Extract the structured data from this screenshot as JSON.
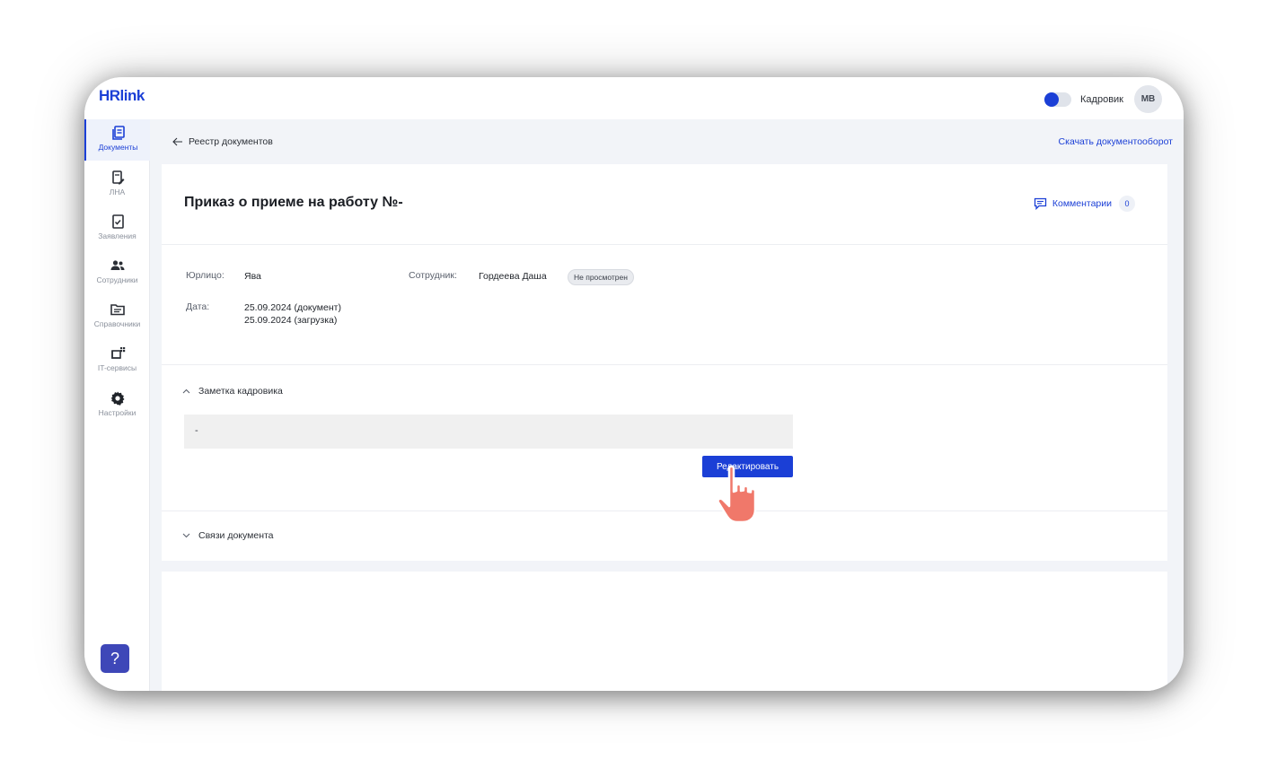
{
  "app": {
    "logo_text": "HRlink"
  },
  "header": {
    "role_label": "Кадровик",
    "avatar_initials": "МВ",
    "role_toggle_on": true
  },
  "sidebar": {
    "items": [
      {
        "label": "Документы",
        "icon": "documents-icon",
        "active": true
      },
      {
        "label": "ЛНА",
        "icon": "lna-icon"
      },
      {
        "label": "Заявления",
        "icon": "applications-icon"
      },
      {
        "label": "Сотрудники",
        "icon": "employees-icon"
      },
      {
        "label": "Справочники",
        "icon": "directories-icon"
      },
      {
        "label": "IT-сервисы",
        "icon": "it-services-icon"
      },
      {
        "label": "Настройки",
        "icon": "settings-icon"
      }
    ],
    "help_label": "?"
  },
  "breadcrumb": {
    "back_label": "Реестр документов",
    "download_label": "Скачать документооборот"
  },
  "document": {
    "title": "Приказ о приеме на работу №-",
    "comments_label": "Комментарии",
    "comments_count": "0",
    "legal_entity_label": "Юрлицо:",
    "legal_entity_value": "Ява",
    "employee_label": "Сотрудник:",
    "employee_value": "Гордеева Даша",
    "status": "Не просмотрен",
    "date_label": "Дата:",
    "date_document": "25.09.2024 (документ)",
    "date_upload": "25.09.2024 (загрузка)"
  },
  "note": {
    "section_label": "Заметка кадровика",
    "value": "-",
    "edit_button": "Редактировать"
  },
  "links": {
    "section_label": "Связи документа"
  },
  "colors": {
    "accent": "#1b3fd6",
    "help": "#3e47b8",
    "cursor": "#f0786a"
  }
}
